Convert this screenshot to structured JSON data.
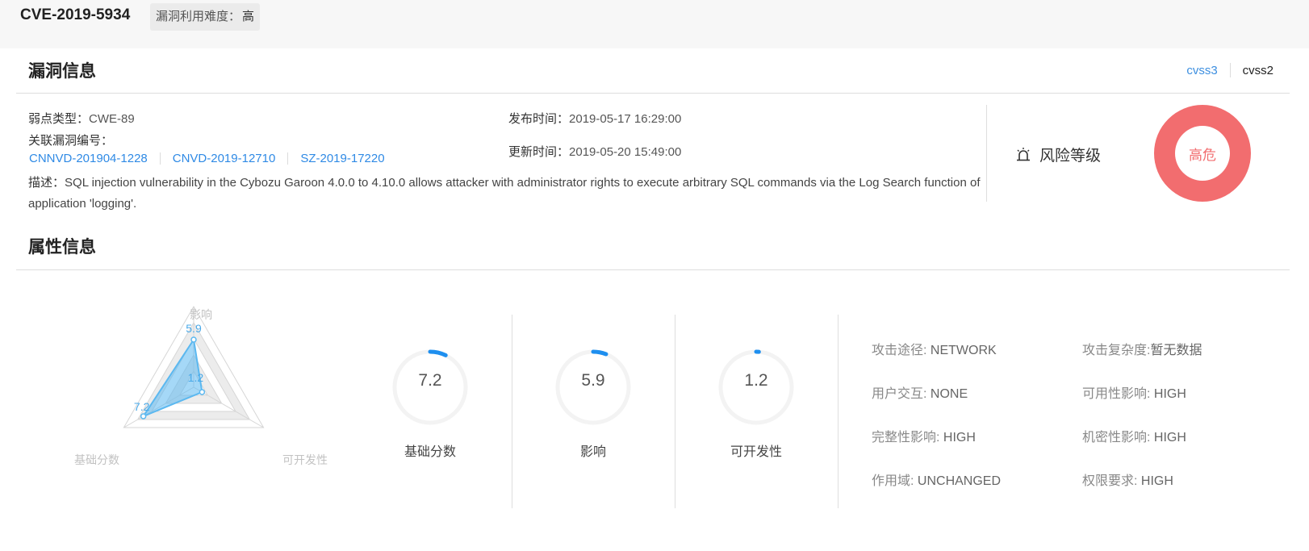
{
  "header": {
    "cve_id": "CVE-2019-5934",
    "difficulty_label": "漏洞利用难度：",
    "difficulty_value": "高"
  },
  "vuln_info": {
    "title": "漏洞信息",
    "tabs": [
      "cvss3",
      "cvss2"
    ],
    "active_tab": "cvss3",
    "weakness_label": "弱点类型：",
    "weakness_value": "CWE-89",
    "related_label": "关联漏洞编号：",
    "related_ids": [
      "CNNVD-201904-1228",
      "CNVD-2019-12710",
      "SZ-2019-17220"
    ],
    "published_label": "发布时间：",
    "published_value": "2019-05-17 16:29:00",
    "updated_label": "更新时间：",
    "updated_value": "2019-05-20 15:49:00",
    "description_label": "描述：",
    "description": "SQL injection vulnerability in the Cybozu Garoon 4.0.0 to 4.10.0 allows attacker with administrator rights to execute arbitrary SQL commands via the Log Search function of application 'logging'.",
    "risk_label": "风险等级",
    "risk_value": "高危",
    "risk_color": "#f26d6f"
  },
  "attributes": {
    "title": "属性信息",
    "radar": {
      "axes": [
        "影响",
        "基础分数",
        "可开发性"
      ],
      "values": [
        5.9,
        7.2,
        1.2
      ],
      "value_labels": [
        "5.9",
        "7.2",
        "1.2"
      ],
      "max": 10,
      "color": "#5bb8f0"
    },
    "gauges": [
      {
        "value": 7.2,
        "display": "7.2",
        "label": "基础分数"
      },
      {
        "value": 5.9,
        "display": "5.9",
        "label": "影响"
      },
      {
        "value": 1.2,
        "display": "1.2",
        "label": "可开发性"
      }
    ],
    "gauge_color": "#1e8fef",
    "items": [
      {
        "label": "攻击途径: ",
        "value": "NETWORK"
      },
      {
        "label": "攻击复杂度:",
        "value": "暂无数据"
      },
      {
        "label": "用户交互: ",
        "value": "NONE"
      },
      {
        "label": "可用性影响: ",
        "value": "HIGH"
      },
      {
        "label": "完整性影响: ",
        "value": "HIGH"
      },
      {
        "label": "机密性影响: ",
        "value": "HIGH"
      },
      {
        "label": "作用域: ",
        "value": "UNCHANGED"
      },
      {
        "label": "权限要求: ",
        "value": "HIGH"
      }
    ]
  }
}
